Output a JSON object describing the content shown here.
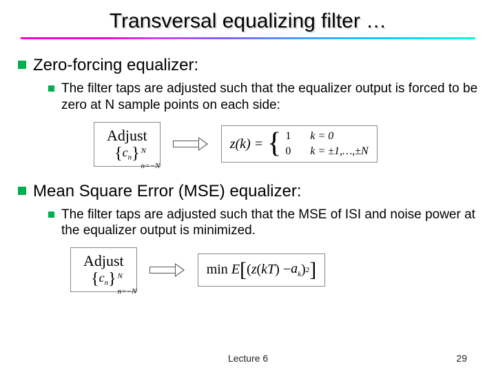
{
  "title": "Transversal equalizing filter …",
  "sections": [
    {
      "heading": "Zero-forcing equalizer:",
      "sub": "The filter taps are adjusted such that the equalizer output is forced to be zero at N sample points on each side:",
      "adjust_label": "Adjust",
      "taps_expr": "{ cₙ }ₙ₌₋ₙᴺ",
      "equation": {
        "lhs": "z(k) =",
        "case1_val": "1",
        "case1_cond": "k = 0",
        "case2_val": "0",
        "case2_cond": "k = ±1,…,±N"
      }
    },
    {
      "heading": "Mean Square Error (MSE) equalizer:",
      "sub": "The filter taps are adjusted such that the MSE of ISI and noise power at the equalizer output is minimized.",
      "adjust_label": "Adjust",
      "taps_expr": "{ cₙ }ₙ₌₋ₙᴺ",
      "equation_text": "min E[ (z(kT) − aₖ)² ]"
    }
  ],
  "footer": {
    "lecture": "Lecture 6",
    "page": "29"
  },
  "chart_data": {
    "type": "table",
    "note": "slide; no plotted data"
  }
}
